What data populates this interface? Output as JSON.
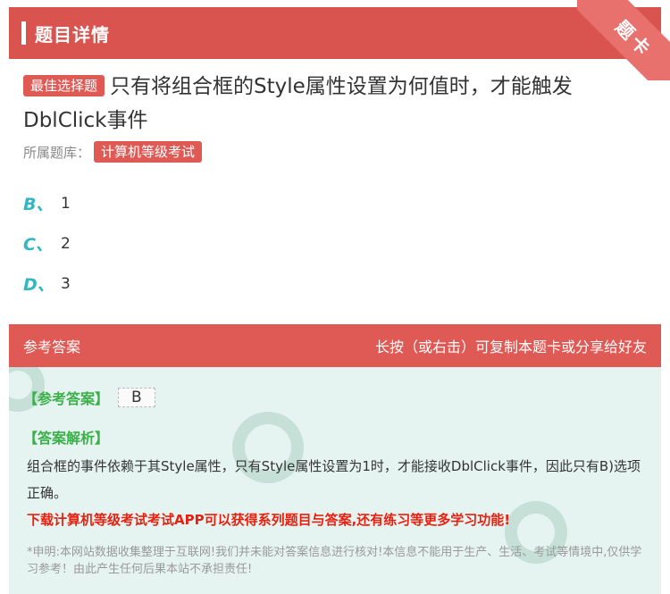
{
  "header": {
    "title": "题目详情",
    "corner_label": "题卡"
  },
  "question": {
    "type_tag": "最佳选择题",
    "text": "只有将组合框的Style属性设置为何值时，才能触发DblClick事件"
  },
  "bank": {
    "label": "所属题库：",
    "name": "计算机等级考试"
  },
  "options": [
    {
      "letter": "B、",
      "text": "1"
    },
    {
      "letter": "C、",
      "text": "2"
    },
    {
      "letter": "D、",
      "text": "3"
    }
  ],
  "answer_bar": {
    "left": "参考答案",
    "right": "长按（或右击）可复制本题卡或分享给好友"
  },
  "answer": {
    "label": "【参考答案】",
    "value": "B",
    "explanation_label": "【答案解析】",
    "explanation": "组合框的事件依赖于其Style属性，只有Style属性设置为1时，才能接收DblClick事件，因此只有B)选项正确。",
    "promo": "下载计算机等级考试考试APP可以获得系列题目与答案,还有练习等更多学习功能!",
    "disclaimer": "*申明:本网站数据收集整理于互联网!我们并未能对答案信息进行核对!本信息不能用于生产、生活、考试等情境中,仅供学习参考！由此产生任何后果本站不承担责任!"
  }
}
